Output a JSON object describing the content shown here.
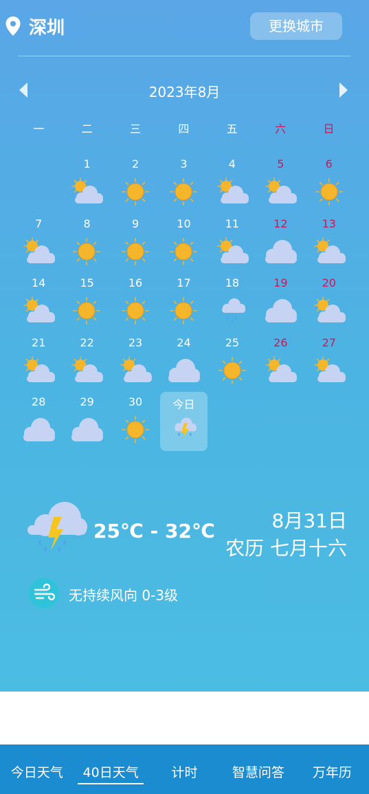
{
  "header": {
    "city": "深圳",
    "change_city_label": "更换城市"
  },
  "calendar": {
    "month_title": "2023年8月",
    "weekdays": [
      "一",
      "二",
      "三",
      "四",
      "五",
      "六",
      "日"
    ],
    "days": [
      {
        "label": "1",
        "icon": "partly-cloudy-icon"
      },
      {
        "label": "2",
        "icon": "sunny-icon"
      },
      {
        "label": "3",
        "icon": "sunny-icon"
      },
      {
        "label": "4",
        "icon": "partly-cloudy-icon"
      },
      {
        "label": "5",
        "icon": "partly-cloudy-icon"
      },
      {
        "label": "6",
        "icon": "sunny-icon"
      },
      {
        "label": "7",
        "icon": "partly-cloudy-icon"
      },
      {
        "label": "8",
        "icon": "sunny-icon"
      },
      {
        "label": "9",
        "icon": "sunny-icon"
      },
      {
        "label": "10",
        "icon": "sunny-icon"
      },
      {
        "label": "11",
        "icon": "partly-cloudy-icon"
      },
      {
        "label": "12",
        "icon": "cloudy-icon"
      },
      {
        "label": "13",
        "icon": "partly-cloudy-icon"
      },
      {
        "label": "14",
        "icon": "partly-cloudy-icon"
      },
      {
        "label": "15",
        "icon": "sunny-icon"
      },
      {
        "label": "16",
        "icon": "sunny-icon"
      },
      {
        "label": "17",
        "icon": "sunny-icon"
      },
      {
        "label": "18",
        "icon": "light-rain-icon"
      },
      {
        "label": "19",
        "icon": "cloudy-icon"
      },
      {
        "label": "20",
        "icon": "partly-cloudy-icon"
      },
      {
        "label": "21",
        "icon": "partly-cloudy-icon"
      },
      {
        "label": "22",
        "icon": "partly-cloudy-icon"
      },
      {
        "label": "23",
        "icon": "partly-cloudy-icon"
      },
      {
        "label": "24",
        "icon": "cloudy-icon"
      },
      {
        "label": "25",
        "icon": "sunny-icon"
      },
      {
        "label": "26",
        "icon": "partly-cloudy-icon"
      },
      {
        "label": "27",
        "icon": "partly-cloudy-icon"
      },
      {
        "label": "28",
        "icon": "cloudy-icon"
      },
      {
        "label": "29",
        "icon": "cloudy-icon"
      },
      {
        "label": "30",
        "icon": "sunny-icon"
      },
      {
        "label": "今日",
        "icon": "thunderstorm-icon",
        "today": true
      }
    ]
  },
  "today": {
    "icon": "thunderstorm-icon",
    "temperature": "25℃ - 32℃",
    "date": "8月31日",
    "lunar": "农历 七月十六",
    "wind": "无持续风向 0-3级"
  },
  "nav": {
    "items": [
      "今日天气",
      "40日天气",
      "计时",
      "智慧问答",
      "万年历"
    ],
    "active": "40日天气"
  },
  "colors": {
    "weekend": "#c8195c",
    "sun": "#f6b62b",
    "cloud": "#c7d3f2",
    "nav_bg": "#1b8cd0",
    "wind_badge": "#2fc3d9"
  }
}
